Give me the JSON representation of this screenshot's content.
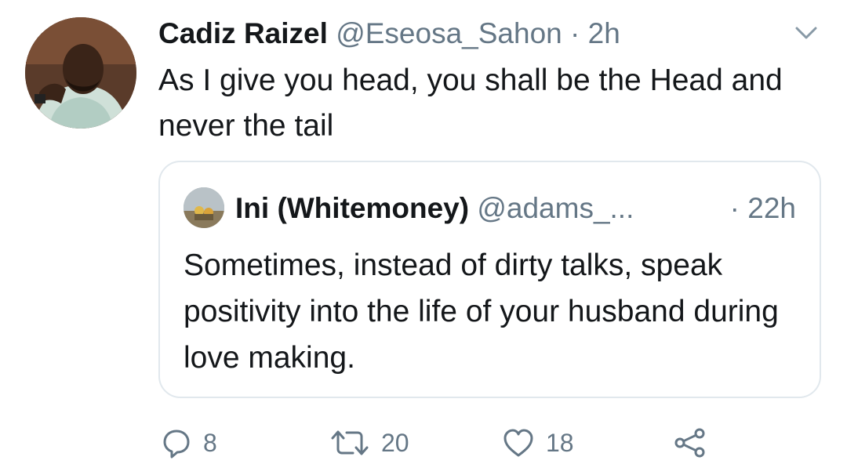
{
  "tweet": {
    "author": {
      "display_name": "Cadiz Raizel",
      "handle": "@Eseosa_Sahon",
      "separator": " · ",
      "time": "2h"
    },
    "text": "As I give you head, you shall be the Head and never the tail",
    "menu_icon": "chevron-down-icon"
  },
  "quoted_tweet": {
    "author": {
      "display_name": "Ini (Whitemoney)",
      "handle": "@adams_...",
      "separator": " · ",
      "time": "22h"
    },
    "text": "Sometimes, instead of dirty talks, speak positivity into the life of your husband during love making."
  },
  "actions": {
    "reply": {
      "icon": "reply-icon",
      "count": "8"
    },
    "retweet": {
      "icon": "retweet-icon",
      "count": "20"
    },
    "like": {
      "icon": "heart-icon",
      "count": "18"
    },
    "share": {
      "icon": "share-icon"
    }
  },
  "colors": {
    "primary_text": "#14171a",
    "secondary_text": "#657786",
    "border": "#e1e8ed",
    "background": "#ffffff"
  }
}
